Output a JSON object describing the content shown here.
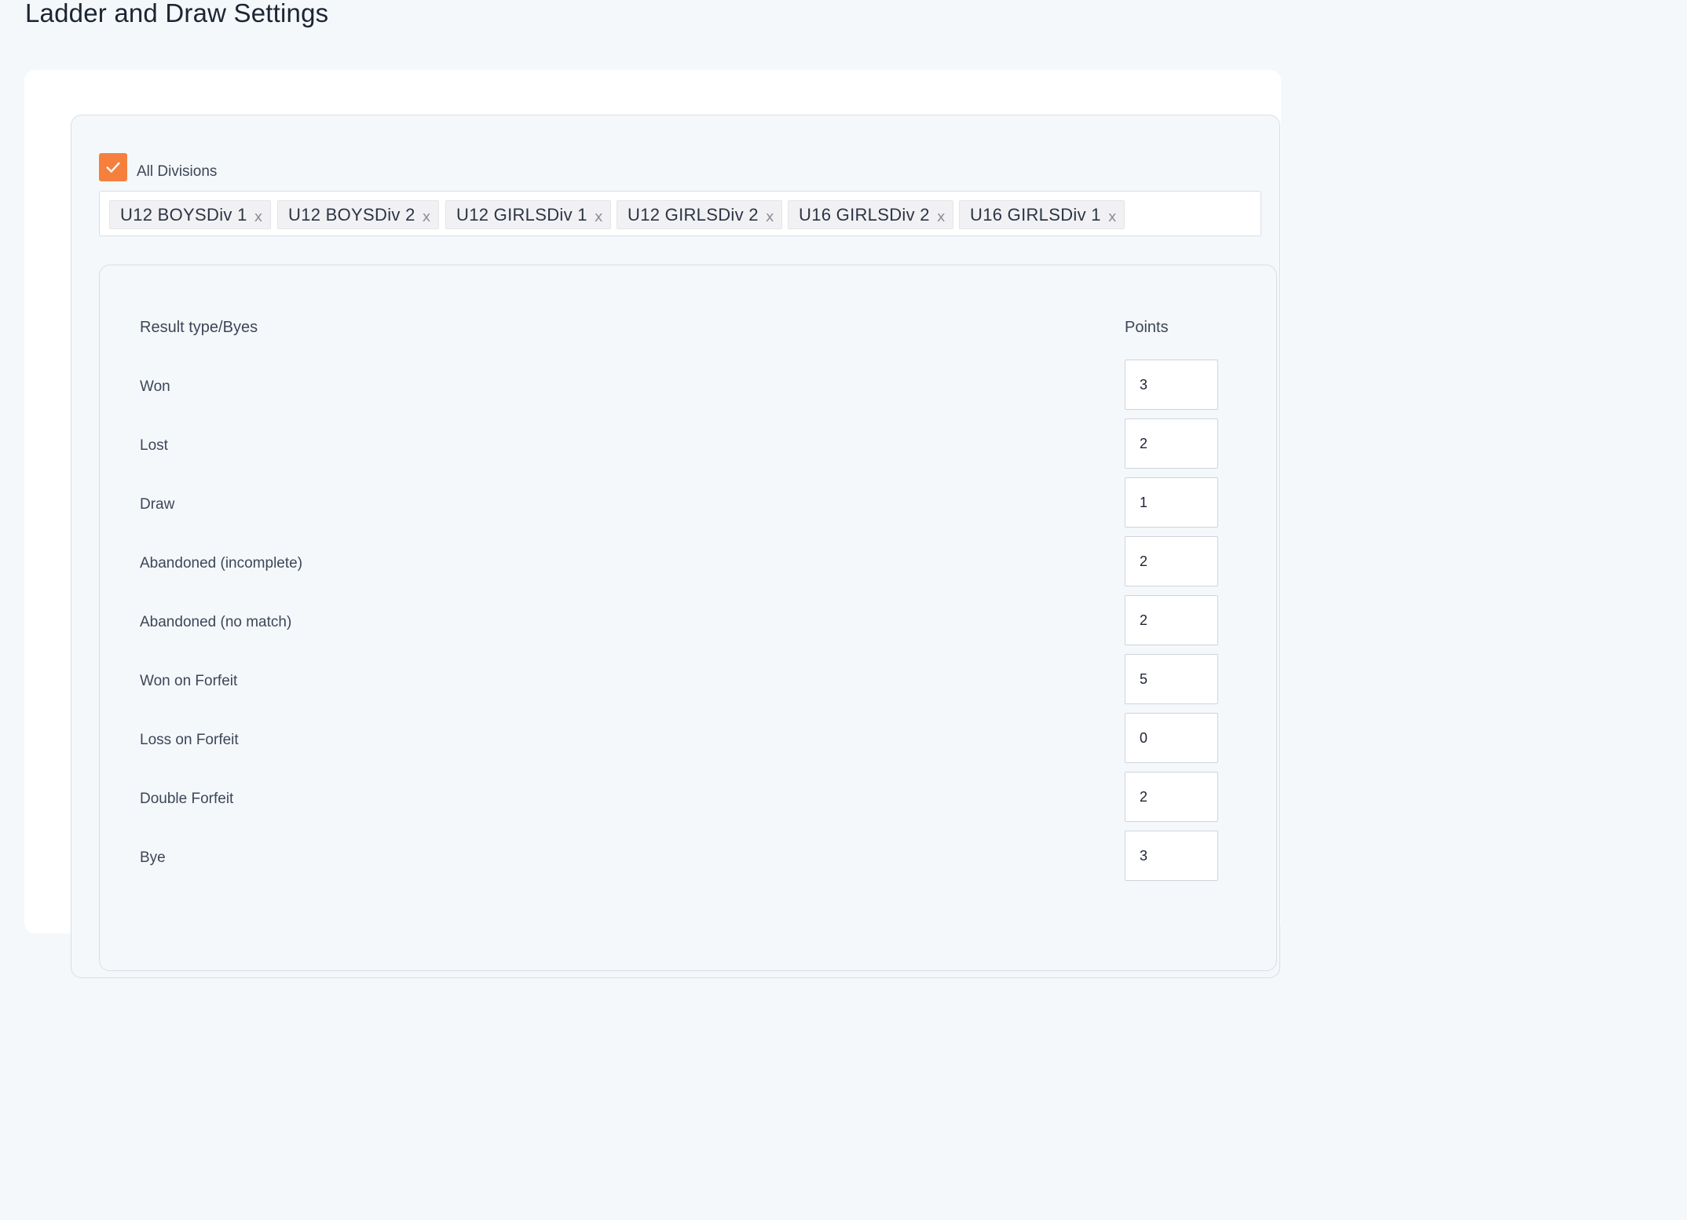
{
  "page": {
    "title": "Ladder and Draw Settings"
  },
  "divisions": {
    "all_label": "All Divisions",
    "all_checked": true,
    "accent": "#f5803e",
    "tags": [
      "U12 BOYSDiv 1",
      "U12 BOYSDiv 2",
      "U12 GIRLSDiv 1",
      "U12 GIRLSDiv 2",
      "U16 GIRLSDiv 2",
      "U16 GIRLSDiv 1"
    ],
    "tag_close_glyph": "x"
  },
  "table": {
    "col_result": "Result type/Byes",
    "col_points": "Points",
    "rows": [
      {
        "label": "Won",
        "points": "3"
      },
      {
        "label": "Lost",
        "points": "2"
      },
      {
        "label": "Draw",
        "points": "1"
      },
      {
        "label": "Abandoned (incomplete)",
        "points": "2"
      },
      {
        "label": "Abandoned (no match)",
        "points": "2"
      },
      {
        "label": "Won on Forfeit",
        "points": "5"
      },
      {
        "label": "Loss on Forfeit",
        "points": "0"
      },
      {
        "label": "Double Forfeit",
        "points": "2"
      },
      {
        "label": "Bye",
        "points": "3"
      }
    ]
  }
}
